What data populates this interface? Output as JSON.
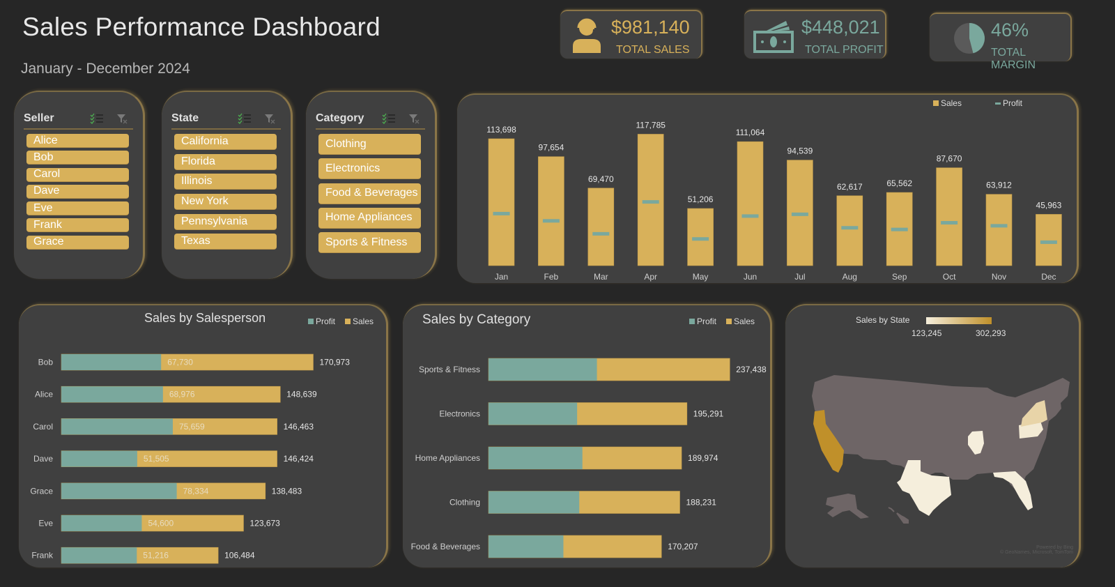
{
  "header": {
    "title": "Sales Performance Dashboard",
    "subtitle": "January - December 2024"
  },
  "colors": {
    "sales": "#d8b15a",
    "profit": "#7aa89d",
    "card_bg": "#404040",
    "page_bg": "#262626",
    "state_default": "#6e6566",
    "gradient_low": "#f5eedc",
    "gradient_high": "#c0902a"
  },
  "kpis": [
    {
      "icon": "headset-person-icon",
      "value": "$981,140",
      "label": "TOTAL SALES",
      "color": "#d8b15a"
    },
    {
      "icon": "money-bill-icon",
      "value": "$448,021",
      "label": "TOTAL PROFIT",
      "color": "#7aa89d"
    },
    {
      "icon": "pie-chart-icon",
      "value": "46%",
      "label": "TOTAL MARGIN",
      "color": "#7aa89d",
      "margin_fraction": 0.46
    }
  ],
  "slicers": [
    {
      "title": "Seller",
      "items": [
        "Alice",
        "Bob",
        "Carol",
        "Dave",
        "Eve",
        "Frank",
        "Grace"
      ]
    },
    {
      "title": "State",
      "items": [
        "California",
        "Florida",
        "Illinois",
        "New York",
        "Pennsylvania",
        "Texas"
      ]
    },
    {
      "title": "Category",
      "items": [
        "Clothing",
        "Electronics",
        "Food & Beverages",
        "Home Appliances",
        "Sports & Fitness"
      ]
    }
  ],
  "chart_data": [
    {
      "id": "monthly",
      "type": "bar",
      "title": "",
      "categories": [
        "Jan",
        "Feb",
        "Mar",
        "Apr",
        "May",
        "Jun",
        "Jul",
        "Aug",
        "Sep",
        "Oct",
        "Nov",
        "Dec"
      ],
      "series": [
        {
          "name": "Sales",
          "type": "bar",
          "values": [
            113698,
            97654,
            69470,
            117785,
            51206,
            111064,
            94539,
            62617,
            65562,
            87670,
            63912,
            45963
          ],
          "labels": [
            "113,698",
            "97,654",
            "69,470",
            "117,785",
            "51,206",
            "111,064",
            "94,539",
            "62,617",
            "65,562",
            "87,670",
            "63,912",
            "45,963"
          ]
        },
        {
          "name": "Profit",
          "type": "marker",
          "values": [
            46600,
            40100,
            28500,
            57100,
            23900,
            44400,
            46000,
            33900,
            32400,
            38400,
            35700,
            21000
          ]
        }
      ],
      "legend": [
        "Sales",
        "Profit"
      ],
      "legend_position": "top-right",
      "ylim": [
        0,
        125000
      ],
      "grid": false
    },
    {
      "id": "salesperson",
      "type": "bar",
      "orientation": "horizontal",
      "title": "Sales by Salesperson",
      "categories": [
        "Bob",
        "Alice",
        "Carol",
        "Dave",
        "Grace",
        "Eve",
        "Frank"
      ],
      "series": [
        {
          "name": "Profit",
          "values": [
            67730,
            68976,
            75659,
            51505,
            78334,
            54600,
            51216
          ],
          "labels": [
            "67,730",
            "68,976",
            "75,659",
            "51,505",
            "78,334",
            "54,600",
            "51,216"
          ]
        },
        {
          "name": "Sales",
          "values": [
            170973,
            148639,
            146463,
            146424,
            138483,
            123673,
            106484
          ],
          "labels": [
            "170,973",
            "148,639",
            "146,463",
            "146,424",
            "138,483",
            "123,673",
            "106,484"
          ]
        }
      ],
      "legend": [
        "Profit",
        "Sales"
      ],
      "legend_position": "top-right",
      "xlim": [
        0,
        175000
      ],
      "grid": false
    },
    {
      "id": "category",
      "type": "bar",
      "orientation": "horizontal",
      "title": "Sales by Category",
      "categories": [
        "Sports & Fitness",
        "Electronics",
        "Home Appliances",
        "Clothing",
        "Food & Beverages"
      ],
      "series": [
        {
          "name": "Profit",
          "values": [
            106700,
            87200,
            92400,
            89300,
            73700
          ]
        },
        {
          "name": "Sales",
          "values": [
            237438,
            195291,
            189974,
            188231,
            170207
          ],
          "labels": [
            "237,438",
            "195,291",
            "189,974",
            "188,231",
            "170,207"
          ]
        }
      ],
      "legend": [
        "Profit",
        "Sales"
      ],
      "legend_position": "top-right",
      "xlim": [
        0,
        240000
      ],
      "grid": false
    },
    {
      "id": "state_map",
      "type": "heatmap",
      "title": "Sales by State",
      "scale_min_label": "123,245",
      "scale_max_label": "302,293",
      "scale_range": [
        123245,
        302293
      ],
      "regions": [
        {
          "state": "California",
          "level": 1.0
        },
        {
          "state": "New York",
          "level": 0.35
        },
        {
          "state": "Pennsylvania",
          "level": 0.05
        },
        {
          "state": "Illinois",
          "level": 0.02
        },
        {
          "state": "Texas",
          "level": 0.03
        },
        {
          "state": "Florida",
          "level": 0.0
        }
      ],
      "attribution": [
        "Powered by Bing",
        "© GeoNames, Microsoft, TomTom"
      ]
    }
  ]
}
